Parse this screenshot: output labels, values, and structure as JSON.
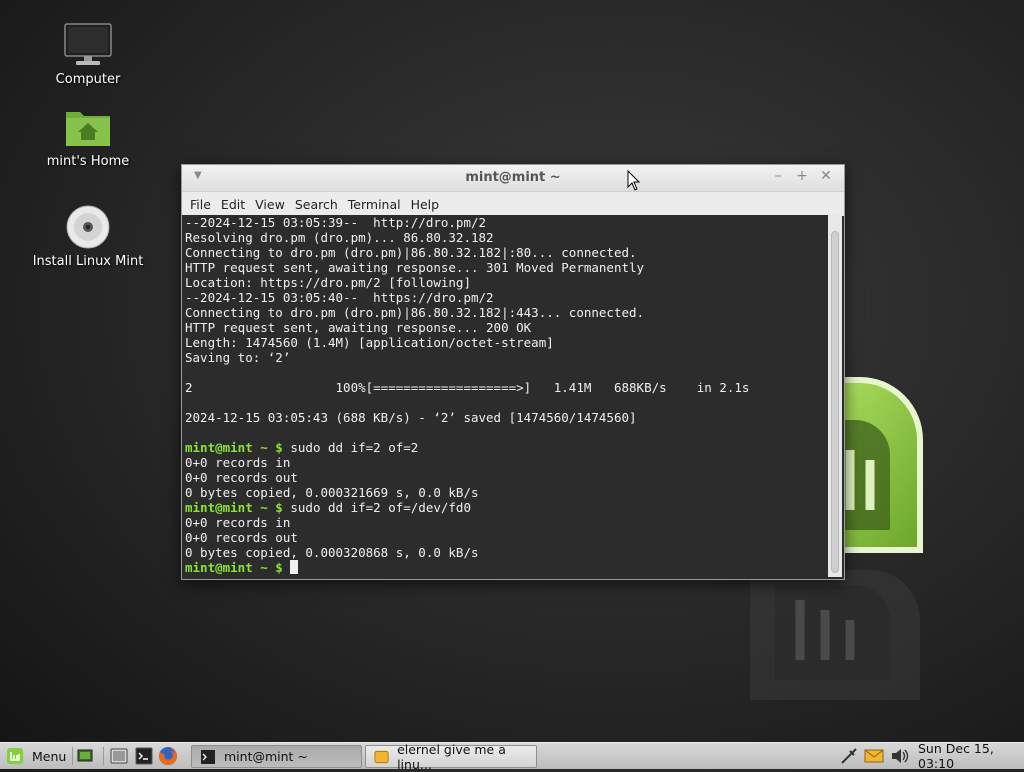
{
  "desktop": {
    "icons": [
      {
        "label": "Computer"
      },
      {
        "label": "mint's Home"
      },
      {
        "label": "Install Linux Mint"
      }
    ]
  },
  "window": {
    "title": "mint@mint ~",
    "menu": [
      "File",
      "Edit",
      "View",
      "Search",
      "Terminal",
      "Help"
    ],
    "terminal_lines": [
      "--2024-12-15 03:05:39--  http://dro.pm/2",
      "Resolving dro.pm (dro.pm)... 86.80.32.182",
      "Connecting to dro.pm (dro.pm)|86.80.32.182|:80... connected.",
      "HTTP request sent, awaiting response... 301 Moved Permanently",
      "Location: https://dro.pm/2 [following]",
      "--2024-12-15 03:05:40--  https://dro.pm/2",
      "Connecting to dro.pm (dro.pm)|86.80.32.182|:443... connected.",
      "HTTP request sent, awaiting response... 200 OK",
      "Length: 1474560 (1.4M) [application/octet-stream]",
      "Saving to: ‘2’",
      "",
      "2                   100%[===================>]   1.41M   688KB/s    in 2.1s",
      "",
      "2024-12-15 03:05:43 (688 KB/s) - ‘2’ saved [1474560/1474560]",
      ""
    ],
    "prompt": "mint@mint ~ $",
    "session": [
      {
        "cmd": " sudo dd if=2 of=2",
        "out": [
          "0+0 records in",
          "0+0 records out",
          "0 bytes copied, 0.000321669 s, 0.0 kB/s"
        ]
      },
      {
        "cmd": " sudo dd if=2 of=/dev/fd0",
        "out": [
          "0+0 records in",
          "0+0 records out",
          "0 bytes copied, 0.000320868 s, 0.0 kB/s"
        ]
      }
    ]
  },
  "panel": {
    "menu_label": "Menu",
    "tasks": [
      {
        "label": "mint@mint ~"
      },
      {
        "label": "elernel give me a linu..."
      }
    ],
    "clock": "Sun Dec 15, 03:10"
  },
  "colors": {
    "prompt_green": "#8ae234",
    "mint_green": "#87cf3e"
  }
}
